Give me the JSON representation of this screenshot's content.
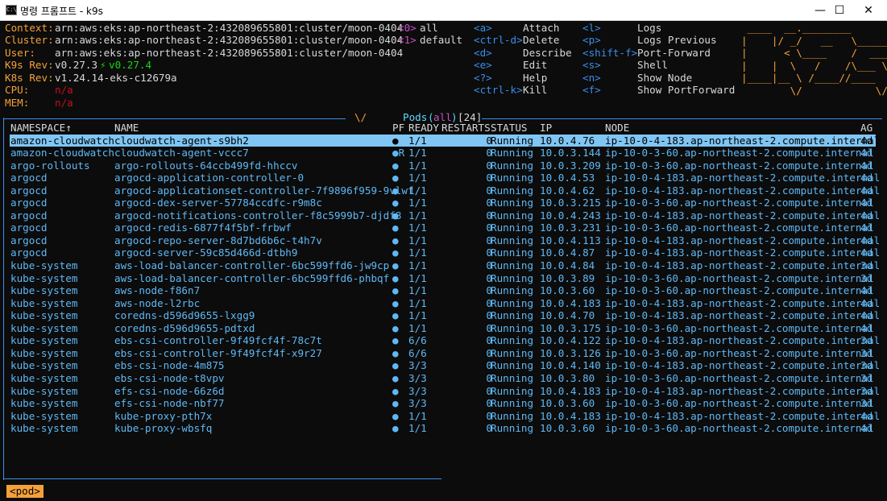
{
  "window": {
    "title": "명령 프롬프트 - k9s",
    "icon": "cmd-icon"
  },
  "info": {
    "context_label": "Context:",
    "context": "arn:aws:eks:ap-northeast-2:432089655801:cluster/moon-0404",
    "cluster_label": "Cluster:",
    "cluster": "arn:aws:eks:ap-northeast-2:432089655801:cluster/moon-0404",
    "user_label": "User:",
    "user": "arn:aws:eks:ap-northeast-2:432089655801:cluster/moon-0404",
    "k9s_rev_label": "K9s Rev:",
    "k9s_rev": "v0.27.3",
    "k9s_update_arrow": "⚡",
    "k9s_latest": "v0.27.4",
    "k8s_rev_label": "K8s Rev:",
    "k8s_rev": "v1.24.14-eks-c12679a",
    "cpu_label": "CPU:",
    "cpu": "n/a",
    "mem_label": "MEM:",
    "mem": "n/a"
  },
  "namespaces": [
    {
      "key": "<0>",
      "label": "all"
    },
    {
      "key": "<1>",
      "label": "default"
    }
  ],
  "shortcuts_col1": [
    {
      "key": "<a>",
      "label": "Attach"
    },
    {
      "key": "<ctrl-d>",
      "label": "Delete"
    },
    {
      "key": "<d>",
      "label": "Describe"
    },
    {
      "key": "<e>",
      "label": "Edit"
    },
    {
      "key": "<?>",
      "label": "Help"
    },
    {
      "key": "<ctrl-k>",
      "label": "Kill"
    }
  ],
  "shortcuts_col2": [
    {
      "key": "<l>",
      "label": "Logs"
    },
    {
      "key": "<p>",
      "label": "Logs Previous"
    },
    {
      "key": "<shift-f>",
      "label": "Port-Forward"
    },
    {
      "key": "<s>",
      "label": "Shell"
    },
    {
      "key": "<n>",
      "label": "Show Node"
    },
    {
      "key": "<f>",
      "label": "Show PortForward"
    }
  ],
  "logo_lines": [
    " ____  __.________       ",
    "|    |/ _/   __   \\______",
    "|      < \\____    /  ___/",
    "|    |  \\   /    /\\___ \\ ",
    "|____|__ \\ /____//____  >",
    "        \\/            \\/ "
  ],
  "table": {
    "title_resource": "Pods",
    "title_open": "(",
    "title_ns": "all",
    "title_close": ")",
    "title_count": "[24]",
    "columns": [
      "NAMESPACE↑",
      "NAME",
      "PF",
      "READY",
      "RESTARTS",
      "STATUS",
      "IP",
      "NODE",
      "AG"
    ],
    "rows": [
      [
        "amazon-cloudwatch",
        "cloudwatch-agent-s9bh2",
        "●",
        "1/1",
        "0",
        "Running",
        "10.0.4.76",
        "ip-10-0-4-183.ap-northeast-2.compute.internal",
        "4d"
      ],
      [
        "amazon-cloudwatch",
        "cloudwatch-agent-vccc7",
        "●R",
        "1/1",
        "0",
        "Running",
        "10.0.3.144",
        "ip-10-0-3-60.ap-northeast-2.compute.internal",
        "4d"
      ],
      [
        "argo-rollouts",
        "argo-rollouts-64ccb499fd-hhccv",
        "●",
        "1/1",
        "0",
        "Running",
        "10.0.3.209",
        "ip-10-0-3-60.ap-northeast-2.compute.internal",
        "4d"
      ],
      [
        "argocd",
        "argocd-application-controller-0",
        "●",
        "1/1",
        "0",
        "Running",
        "10.0.4.53",
        "ip-10-0-4-183.ap-northeast-2.compute.internal",
        "4d"
      ],
      [
        "argocd",
        "argocd-applicationset-controller-7f9896f959-9vlwf",
        "●",
        "1/1",
        "0",
        "Running",
        "10.0.4.62",
        "ip-10-0-4-183.ap-northeast-2.compute.internal",
        "4d"
      ],
      [
        "argocd",
        "argocd-dex-server-57784ccdfc-r9m8c",
        "●",
        "1/1",
        "0",
        "Running",
        "10.0.3.215",
        "ip-10-0-3-60.ap-northeast-2.compute.internal",
        "4d"
      ],
      [
        "argocd",
        "argocd-notifications-controller-f8c5999b7-djdf8",
        "●",
        "1/1",
        "0",
        "Running",
        "10.0.4.243",
        "ip-10-0-4-183.ap-northeast-2.compute.internal",
        "4d"
      ],
      [
        "argocd",
        "argocd-redis-6877f4f5bf-frbwf",
        "●",
        "1/1",
        "0",
        "Running",
        "10.0.3.231",
        "ip-10-0-3-60.ap-northeast-2.compute.internal",
        "4d"
      ],
      [
        "argocd",
        "argocd-repo-server-8d7bd6b6c-t4h7v",
        "●",
        "1/1",
        "0",
        "Running",
        "10.0.4.113",
        "ip-10-0-4-183.ap-northeast-2.compute.internal",
        "4d"
      ],
      [
        "argocd",
        "argocd-server-59c85d466d-dtbh9",
        "●",
        "1/1",
        "0",
        "Running",
        "10.0.4.87",
        "ip-10-0-4-183.ap-northeast-2.compute.internal",
        "4d"
      ],
      [
        "kube-system",
        "aws-load-balancer-controller-6bc599ffd6-jw9cp",
        "●",
        "1/1",
        "0",
        "Running",
        "10.0.4.84",
        "ip-10-0-4-183.ap-northeast-2.compute.internal",
        "3d"
      ],
      [
        "kube-system",
        "aws-load-balancer-controller-6bc599ffd6-phbqf",
        "●",
        "1/1",
        "0",
        "Running",
        "10.0.3.89",
        "ip-10-0-3-60.ap-northeast-2.compute.internal",
        "3d"
      ],
      [
        "kube-system",
        "aws-node-f86n7",
        "●",
        "1/1",
        "0",
        "Running",
        "10.0.3.60",
        "ip-10-0-3-60.ap-northeast-2.compute.internal",
        "4d"
      ],
      [
        "kube-system",
        "aws-node-l2rbc",
        "●",
        "1/1",
        "0",
        "Running",
        "10.0.4.183",
        "ip-10-0-4-183.ap-northeast-2.compute.internal",
        "4d"
      ],
      [
        "kube-system",
        "coredns-d596d9655-lxgg9",
        "●",
        "1/1",
        "0",
        "Running",
        "10.0.4.70",
        "ip-10-0-4-183.ap-northeast-2.compute.internal",
        "4d"
      ],
      [
        "kube-system",
        "coredns-d596d9655-pdtxd",
        "●",
        "1/1",
        "0",
        "Running",
        "10.0.3.175",
        "ip-10-0-3-60.ap-northeast-2.compute.internal",
        "4d"
      ],
      [
        "kube-system",
        "ebs-csi-controller-9f49fcf4f-78c7t",
        "●",
        "6/6",
        "0",
        "Running",
        "10.0.4.122",
        "ip-10-0-4-183.ap-northeast-2.compute.internal",
        "3d"
      ],
      [
        "kube-system",
        "ebs-csi-controller-9f49fcf4f-x9r27",
        "●",
        "6/6",
        "0",
        "Running",
        "10.0.3.126",
        "ip-10-0-3-60.ap-northeast-2.compute.internal",
        "3d"
      ],
      [
        "kube-system",
        "ebs-csi-node-4m875",
        "●",
        "3/3",
        "0",
        "Running",
        "10.0.4.140",
        "ip-10-0-4-183.ap-northeast-2.compute.internal",
        "3d"
      ],
      [
        "kube-system",
        "ebs-csi-node-t8vpv",
        "●",
        "3/3",
        "0",
        "Running",
        "10.0.3.80",
        "ip-10-0-3-60.ap-northeast-2.compute.internal",
        "3d"
      ],
      [
        "kube-system",
        "efs-csi-node-66z6d",
        "●",
        "3/3",
        "0",
        "Running",
        "10.0.4.183",
        "ip-10-0-4-183.ap-northeast-2.compute.internal",
        "3d"
      ],
      [
        "kube-system",
        "efs-csi-node-nbf77",
        "●",
        "3/3",
        "0",
        "Running",
        "10.0.3.60",
        "ip-10-0-3-60.ap-northeast-2.compute.internal",
        "3d"
      ],
      [
        "kube-system",
        "kube-proxy-pth7x",
        "●",
        "1/1",
        "0",
        "Running",
        "10.0.4.183",
        "ip-10-0-4-183.ap-northeast-2.compute.internal",
        "4d"
      ],
      [
        "kube-system",
        "kube-proxy-wbsfq",
        "●",
        "1/1",
        "0",
        "Running",
        "10.0.3.60",
        "ip-10-0-3-60.ap-northeast-2.compute.internal",
        "4d"
      ]
    ]
  },
  "breadcrumb": "<pod>",
  "colors": {
    "header_label": "#f5a13a",
    "key": "#c552c5",
    "row_text": "#5fb8f5",
    "selected_bg": "#7fc6f5",
    "border": "#3b8eea",
    "logo": "#f5a13a"
  }
}
